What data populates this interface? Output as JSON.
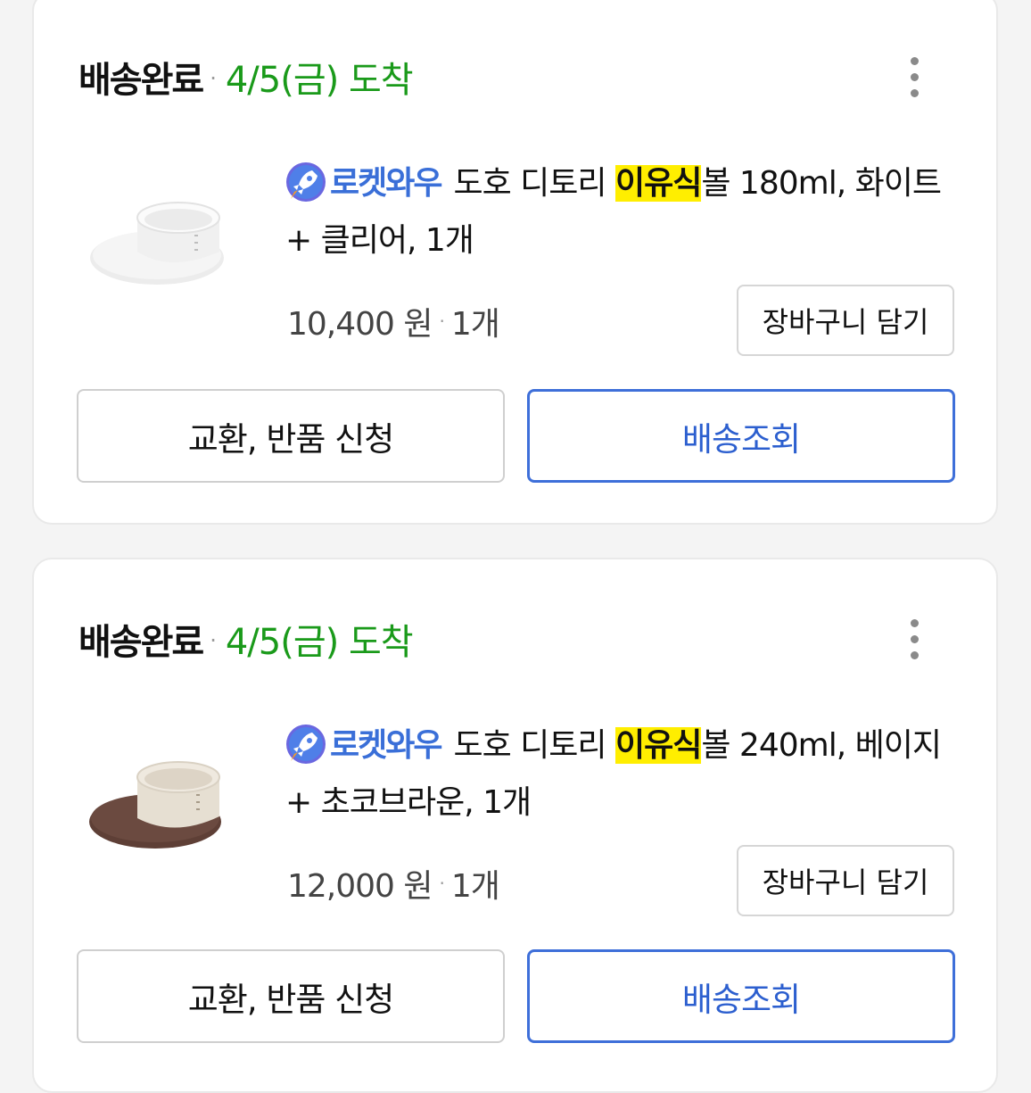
{
  "orders": [
    {
      "status": "배송완료",
      "arrival": "4/5(금) 도착",
      "badge": "로켓와우",
      "product_prefix": "도호 디토리 ",
      "product_highlight": "이유식",
      "product_suffix": "볼 180ml, 화이트 + 클리어, 1개",
      "price": "10,400 원",
      "quantity": "1개",
      "cart_label": "장바구니 담기",
      "return_label": "교환, 반품 신청",
      "track_label": "배송조회",
      "image_colors": {
        "bowl": "#f2f2f2",
        "lid": "#ececec"
      }
    },
    {
      "status": "배송완료",
      "arrival": "4/5(금) 도착",
      "badge": "로켓와우",
      "product_prefix": "도호 디토리 ",
      "product_highlight": "이유식",
      "product_suffix": "볼 240ml, 베이지 + 초코브라운, 1개",
      "price": "12,000 원",
      "quantity": "1개",
      "cart_label": "장바구니 담기",
      "return_label": "교환, 반품 신청",
      "track_label": "배송조회",
      "image_colors": {
        "bowl": "#e9e3d8",
        "lid": "#6b4a40"
      }
    }
  ],
  "colors": {
    "status_green": "#1a9a1a",
    "accent_blue": "#3e6fd9",
    "highlight_yellow": "#ffee00"
  },
  "icons": [
    "rocket-icon",
    "more-vertical-icon"
  ]
}
